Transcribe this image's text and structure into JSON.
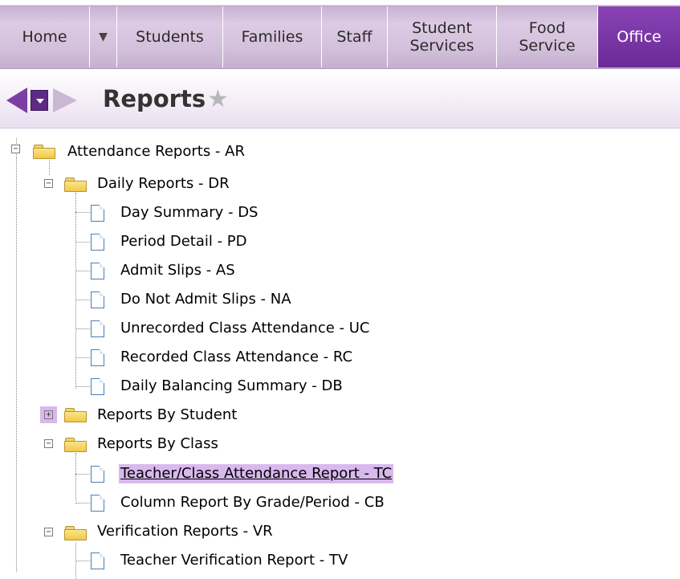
{
  "nav": {
    "tabs": [
      {
        "label": "Home"
      },
      {
        "label": "▼"
      },
      {
        "label": "Students"
      },
      {
        "label": "Families"
      },
      {
        "label": "Staff"
      },
      {
        "label": "Student Services",
        "line1": "Student",
        "line2": "Services"
      },
      {
        "label": "Food Service",
        "line1": "Food",
        "line2": "Service"
      },
      {
        "label": "Office",
        "active": true
      }
    ]
  },
  "header": {
    "title": "Reports",
    "star_glyph": "★"
  },
  "tree": {
    "root": {
      "label": "Attendance Reports - AR",
      "expander": "−"
    },
    "daily": {
      "label": "Daily Reports - DR",
      "expander": "−",
      "items": [
        "Day Summary - DS",
        "Period Detail - PD",
        "Admit Slips - AS",
        "Do Not Admit Slips - NA",
        "Unrecorded Class Attendance - UC",
        "Recorded Class Attendance - RC",
        "Daily Balancing Summary - DB"
      ]
    },
    "by_student": {
      "label": "Reports By Student",
      "expander": "+"
    },
    "by_class": {
      "label": "Reports By Class",
      "expander": "−",
      "items": [
        "Teacher/Class Attendance Report - TC",
        "Column Report By Grade/Period - CB"
      ]
    },
    "verification": {
      "label": "Verification Reports - VR",
      "expander": "−",
      "items": [
        "Teacher Verification Report - TV"
      ]
    }
  },
  "colors": {
    "accent": "#6a2a97",
    "selection": "#d9b8ee",
    "nav_bg": "#d3c0dc"
  },
  "icons": [
    "back-arrow-icon",
    "menu-dropdown-icon",
    "forward-arrow-icon",
    "star-icon",
    "folder-icon",
    "document-icon"
  ]
}
